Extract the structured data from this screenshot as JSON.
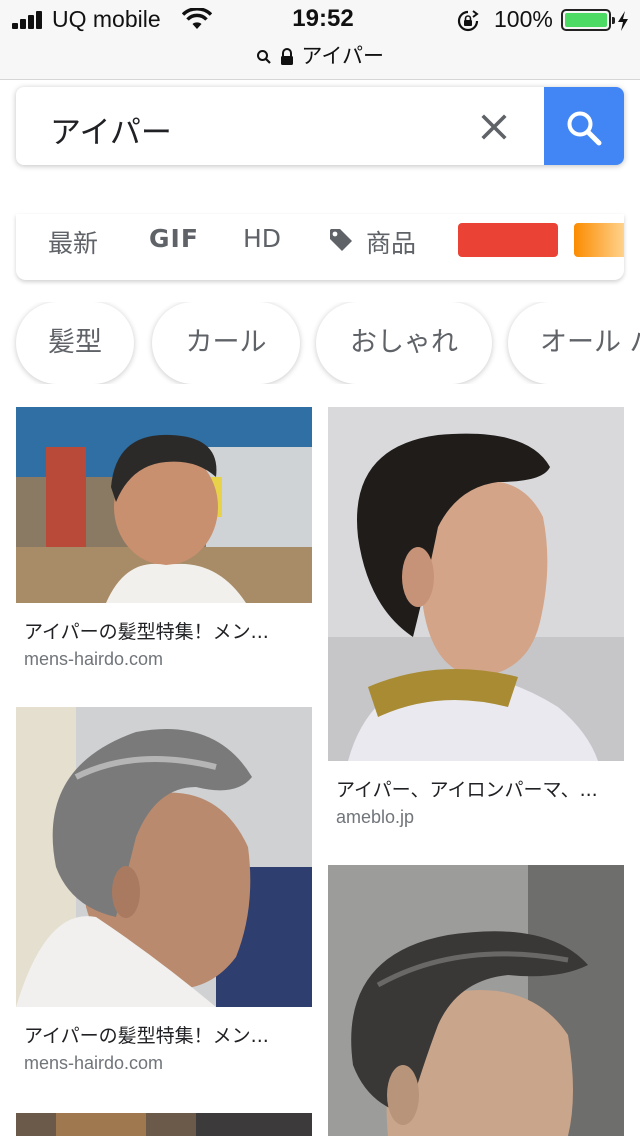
{
  "status": {
    "carrier": "UQ mobile",
    "time": "19:52",
    "battery_pct": "100%",
    "battery_level": 1.0,
    "colors": {
      "battery": "#4cd964"
    }
  },
  "url_bar": {
    "text": "アイパー",
    "icons": [
      "search-icon",
      "lock-icon"
    ]
  },
  "search": {
    "query": "アイパー",
    "clear_icon": "close-icon",
    "search_icon": "search-icon",
    "colors": {
      "button": "#4285f4"
    }
  },
  "filters": {
    "latest": "最新",
    "gif": "GIF",
    "hd": "HD",
    "products": "商品",
    "color_swatches": [
      "#ea4335",
      "#fb8c00"
    ]
  },
  "chips": [
    "髪型",
    "カール",
    "おしゃれ",
    "オール バ"
  ],
  "results": [
    {
      "title": "アイパーの髪型特集！メン...",
      "source": "mens-hairdo.com"
    },
    {
      "title": "アイパー、アイロンパーマ、...",
      "source": "ameblo.jp"
    },
    {
      "title": "アイパーの髪型特集！メン...",
      "source": "mens-hairdo.com"
    }
  ]
}
